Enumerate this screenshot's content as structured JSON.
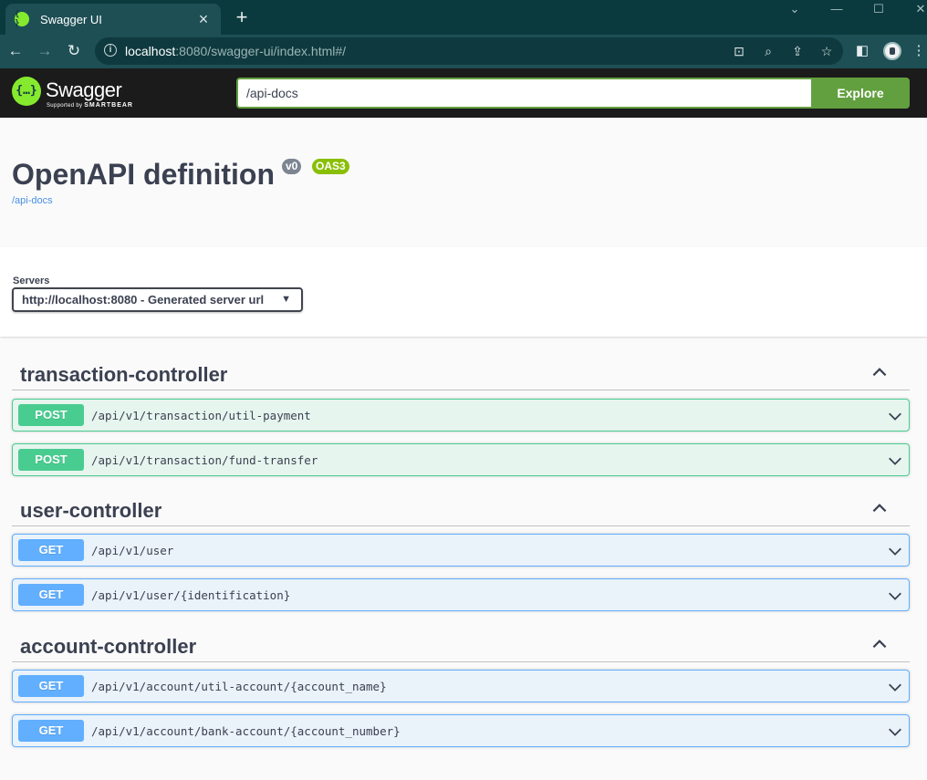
{
  "browser": {
    "tab_title": "Swagger UI",
    "tab_favicon": "{ }",
    "url_host": "localhost",
    "url_rest": ":8080/swagger-ui/index.html#/"
  },
  "topbar": {
    "brand": "Swagger",
    "supported_by": "Supported by",
    "smartbear": "SMARTBEAR",
    "url_value": "/api-docs",
    "explore_label": "Explore"
  },
  "info": {
    "title": "OpenAPI definition",
    "version": "v0",
    "oas": "OAS3",
    "link": "/api-docs"
  },
  "servers": {
    "label": "Servers",
    "selected": "http://localhost:8080 - Generated server url"
  },
  "tags": [
    {
      "name": "transaction-controller",
      "ops": [
        {
          "method": "POST",
          "path": "/api/v1/transaction/util-payment"
        },
        {
          "method": "POST",
          "path": "/api/v1/transaction/fund-transfer"
        }
      ]
    },
    {
      "name": "user-controller",
      "ops": [
        {
          "method": "GET",
          "path": "/api/v1/user"
        },
        {
          "method": "GET",
          "path": "/api/v1/user/{identification}"
        }
      ]
    },
    {
      "name": "account-controller",
      "ops": [
        {
          "method": "GET",
          "path": "/api/v1/account/util-account/{account_name}"
        },
        {
          "method": "GET",
          "path": "/api/v1/account/bank-account/{account_number}"
        }
      ]
    }
  ],
  "colors": {
    "post": "#49cc90",
    "get": "#61affe",
    "explore": "#62a03f",
    "swagger_green": "#85ea2d"
  }
}
